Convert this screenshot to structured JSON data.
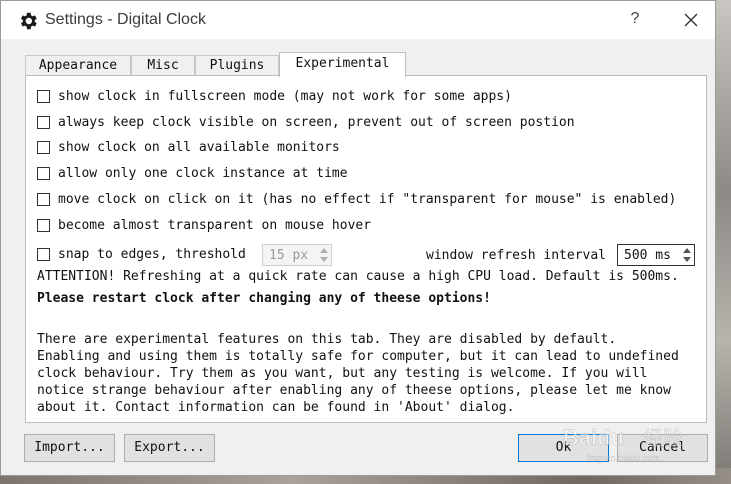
{
  "window": {
    "title": "Settings - Digital Clock",
    "help_label": "?"
  },
  "tabs": [
    {
      "label": "Appearance",
      "active": false
    },
    {
      "label": "Misc",
      "active": false
    },
    {
      "label": "Plugins",
      "active": false
    },
    {
      "label": "Experimental",
      "active": true
    }
  ],
  "options": [
    {
      "label": "show clock in fullscreen mode (may not work for some apps)",
      "checked": false
    },
    {
      "label": "always keep clock visible on screen, prevent out of screen postion",
      "checked": false
    },
    {
      "label": "show clock on all available monitors",
      "checked": false
    },
    {
      "label": "allow only one clock instance at time",
      "checked": false
    },
    {
      "label": "move clock on click on it (has no effect if \"transparent for mouse\" is enabled)",
      "checked": false
    },
    {
      "label": "become almost transparent on mouse hover",
      "checked": false
    },
    {
      "label": "snap to edges, threshold",
      "checked": false
    }
  ],
  "snap_threshold": {
    "value": "15 px",
    "enabled": false
  },
  "refresh": {
    "label": "window refresh interval",
    "value": "500 ms"
  },
  "attention": "ATTENTION! Refreshing at a quick rate can cause a high CPU load. Default is 500ms.",
  "restart_notice": "Please restart clock after changing any of theese options!",
  "description": [
    "There are experimental features on this tab. They are disabled by default.",
    "Enabling and using them is totally safe for computer, but it can lead to undefined",
    "clock behaviour. Try them as you want, but any testing is welcome. If you will",
    "notice strange behaviour after enabling any of theese options, please let me know",
    "about it. Contact information can be found in 'About' dialog."
  ],
  "buttons": {
    "import": "Import...",
    "export": "Export...",
    "ok": "Ok",
    "cancel": "Cancel"
  },
  "watermark": {
    "brand": "Baidu",
    "sub": "经验",
    "url": "jingyan.baidu.com"
  },
  "colors": {
    "window_bg": "#f0f0f0",
    "panel_bg": "#ffffff",
    "button_bg": "#e1e1e1"
  }
}
